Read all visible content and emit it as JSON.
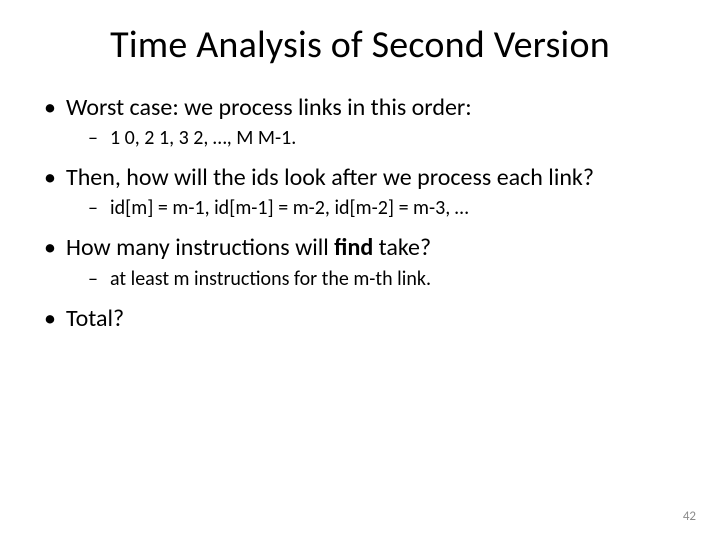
{
  "title": "Time Analysis of Second Version",
  "bullets": [
    {
      "text": "Worst case: we process links in this order:",
      "sub": [
        "1 0, 2 1, 3 2, …, M M-1."
      ]
    },
    {
      "text": "Then, how will the ids look after we process each link?",
      "sub": [
        "id[m] = m-1, id[m-1] = m-2, id[m-2] = m-3, …"
      ]
    },
    {
      "pre": "How many instructions will ",
      "bold": "find",
      "post": " take?",
      "sub": [
        "at least m instructions for the m-th link."
      ]
    },
    {
      "text": "Total?",
      "sub": []
    }
  ],
  "pageNumber": "42"
}
